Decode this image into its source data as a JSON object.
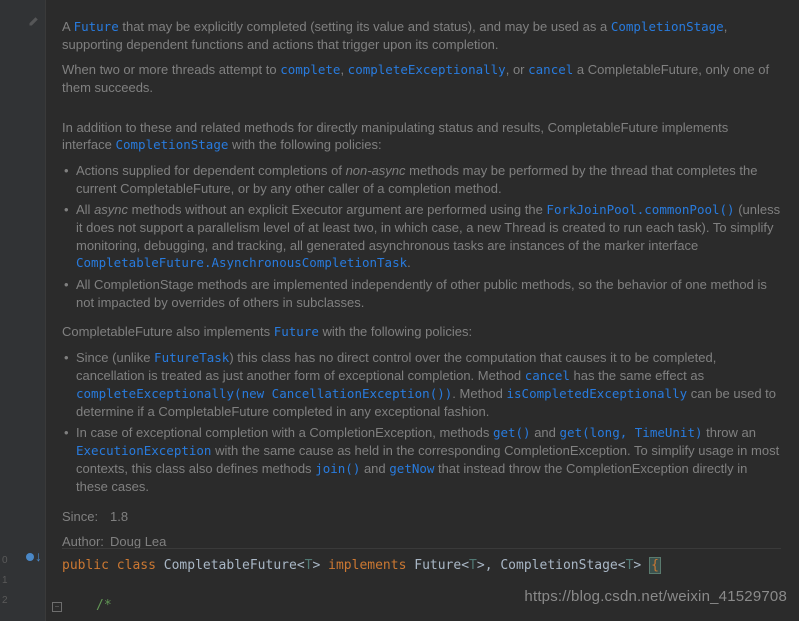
{
  "doc": {
    "p1a": "A ",
    "future": "Future",
    "p1b": " that may be explicitly completed (setting its value and status), and may be used as a ",
    "cstage": "CompletionStage",
    "p1c": ", supporting dependent functions and actions that trigger upon its completion.",
    "p2a": "When two or more threads attempt to ",
    "complete": "complete",
    "p2b": ", ",
    "completeEx": "completeExceptionally",
    "p2c": ", or ",
    "cancel": "cancel",
    "p2d": " a CompletableFuture, only one of them succeeds.",
    "p3a": "In addition to these and related methods for directly manipulating status and results, CompletableFuture implements interface ",
    "cstage2": "CompletionStage",
    "p3b": " with the following policies:",
    "b1a": "Actions supplied for dependent completions of ",
    "b1_nonasync": "non-async",
    "b1b": " methods may be performed by the thread that completes the current CompletableFuture, or by any other caller of a completion method.",
    "b2a": "All ",
    "b2_async": "async",
    "b2b": " methods without an explicit Executor argument are performed using the ",
    "fjp": "ForkJoinPool",
    "dot1": ".",
    "commonPool": "commonPool()",
    "b2c": " (unless it does not support a parallelism level of at least two, in which case, a new Thread is created to run each task). To simplify monitoring, debugging, and tracking, all generated asynchronous tasks are instances of the marker interface ",
    "cf": "CompletableFuture",
    "dot2": ".",
    "act": "AsynchronousCompletionTask",
    "dot3": ".",
    "b3": "All CompletionStage methods are implemented independently of other public methods, so the behavior of one method is not impacted by overrides of others in subclasses.",
    "p4a": "CompletableFuture also implements ",
    "future2": "Future",
    "p4b": " with the following policies:",
    "c1a": "Since (unlike ",
    "futureTask": "FutureTask",
    "c1b": ") this class has no direct control over the computation that causes it to be completed, cancellation is treated as just another form of exceptional completion. Method ",
    "cancel2": "cancel",
    "c1c": " has the same effect as ",
    "cex_call": "completeExceptionally(new CancellationException())",
    "c1d": ". Method ",
    "isCE": "isCompletedExceptionally",
    "c1e": " can be used to determine if a CompletableFuture completed in any exceptional fashion.",
    "c2a": "In case of exceptional completion with a CompletionException, methods ",
    "get0": "get()",
    "c2b": " and ",
    "getlt": "get(long, TimeUnit)",
    "c2c": " throw an ",
    "ee": "ExecutionException",
    "c2d": " with the same cause as held in the corresponding CompletionException. To simplify usage in most contexts, this class also defines methods ",
    "join": "join()",
    "c2e": " and ",
    "getNow": "getNow",
    "c2f": " that instead throw the CompletionException directly in these cases.",
    "since_label": "Since:",
    "since_val": "1.8",
    "author_label": "Author:",
    "author_val": "Doug Lea"
  },
  "code": {
    "public": "public",
    "class": "class",
    "name": "CompletableFuture",
    "lt1": "<",
    "T1": "T",
    "gt1": ">",
    "implements": "implements",
    "future": "Future",
    "lt2": "<",
    "T2": "T",
    "gt2": ">",
    "comma": ",",
    "cstage": "CompletionStage",
    "lt3": "<",
    "T3": "T",
    "gt3": ">",
    "brace": "{",
    "comment": "/*"
  },
  "line_numbers": [
    "0",
    "1",
    "2"
  ],
  "watermark": "https://blog.csdn.net/weixin_41529708"
}
